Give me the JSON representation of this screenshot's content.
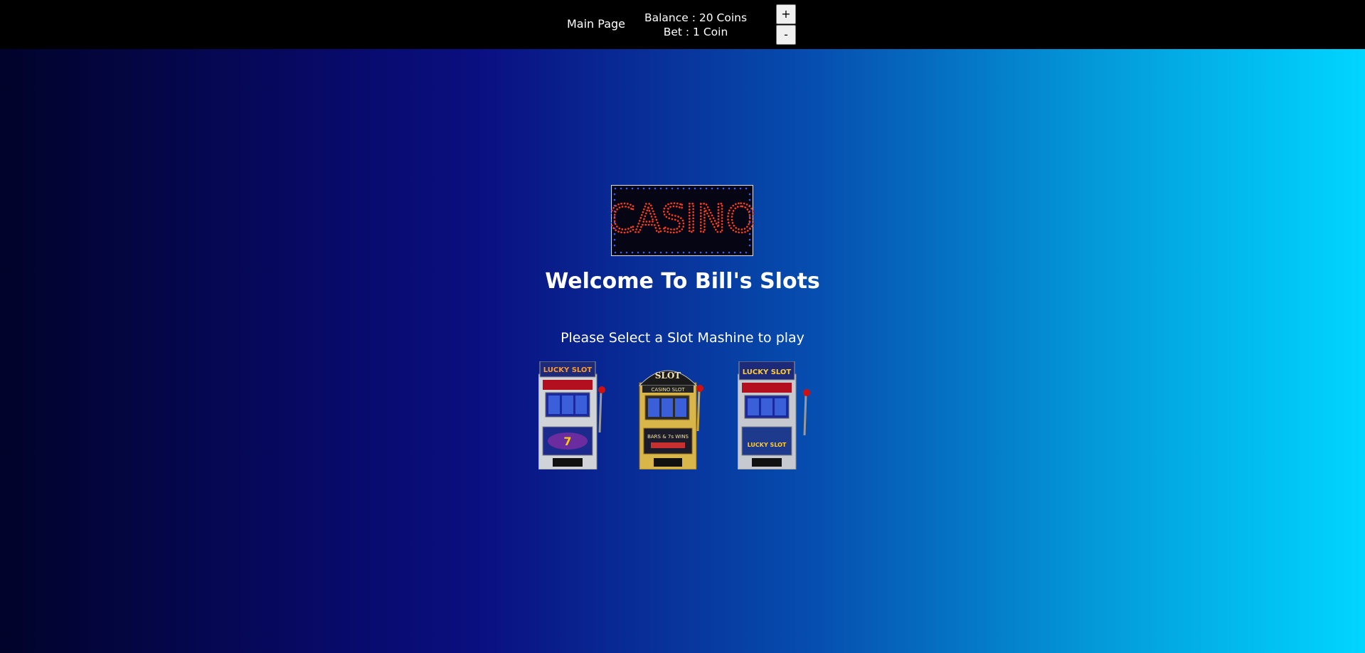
{
  "nav": {
    "main_page_label": "Main Page"
  },
  "status": {
    "balance_text": "Balance : 20 Coins",
    "bet_text": "Bet : 1 Coin"
  },
  "bet_controls": {
    "increase_label": "+",
    "decrease_label": "-"
  },
  "hero": {
    "sign_text": "CASINO",
    "welcome_text": "Welcome To Bill's Slots",
    "instruction_text": "Please Select a Slot Mashine to play"
  },
  "slots": [
    {
      "top_sign": "LUCKY SLOT",
      "bottom_text": "7",
      "body_color": "#c9ccd2",
      "sign_color": "#1d2a7a"
    },
    {
      "top_sign": "SLOT",
      "sub_sign": "CASINO SLOT",
      "bottom_text": "BARS & 7s WINS",
      "body_color": "#d9b64a",
      "sign_color": "#1a1a1a"
    },
    {
      "top_sign": "LUCKY SLOT",
      "bottom_text": "LUCKY SLOT",
      "body_color": "#c9ccd2",
      "sign_color": "#1d2a7a"
    }
  ],
  "colors": {
    "topbar": "#000000",
    "gradient_left": "#01032a",
    "gradient_mid": "#0a0f80",
    "gradient_right": "#00d6ff",
    "sign_text": "#ff3b1f",
    "sign_border_dots": "#3a5bff",
    "lever_ball": "#d01010"
  }
}
